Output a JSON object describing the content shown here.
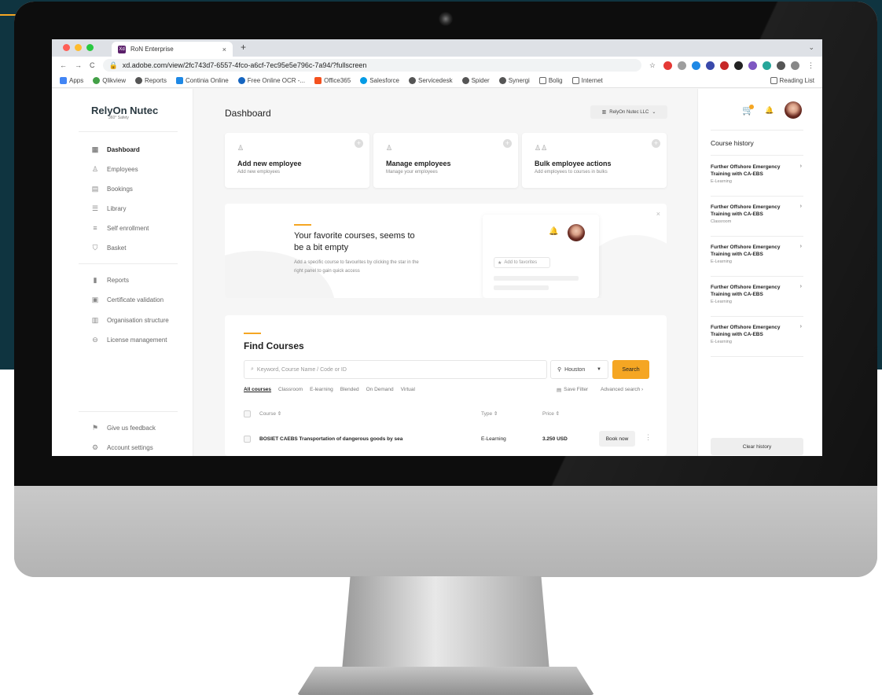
{
  "browser": {
    "tab_title": "RoN Enterprise",
    "tab_close": "×",
    "new_tab": "+",
    "tab_menu": "⌄",
    "url": "xd.adobe.com/view/2fc743d7-6557-4fco-a6cf-7ec95e5e796c-7a94/?fullscreen",
    "bookmarks": [
      "Apps",
      "Qlikview",
      "Reports",
      "Continia Online",
      "Free Online OCR -...",
      "Office365",
      "Salesforce",
      "Servicedesk",
      "Spider",
      "Synergi",
      "Bolig",
      "Internet"
    ],
    "reading_list": "Reading List"
  },
  "sidebar": {
    "logo": "RelyOn Nutec",
    "logo_sub": "360° Safety",
    "items": [
      "Dashboard",
      "Employees",
      "Bookings",
      "Library",
      "Self enrollment",
      "Basket"
    ],
    "items2": [
      "Reports",
      "Certificate validation",
      "Organisation structure",
      "License management"
    ],
    "bottom": [
      "Give us feedback",
      "Account settings"
    ]
  },
  "main": {
    "title": "Dashboard",
    "org_selector": "RelyOn Nutec LLC",
    "cards": [
      {
        "title": "Add new employee",
        "sub": "Add new employees"
      },
      {
        "title": "Manage employees",
        "sub": "Manage your employees"
      },
      {
        "title": "Bulk employee actions",
        "sub": "Add employees to courses in bulks"
      }
    ],
    "favorites": {
      "title": "Your favorite courses, seems to be a bit empty",
      "text": "Add a specific course to favourites by clicking the star in the right panel to gain quick access",
      "add_label": "Add to favorites"
    },
    "find": {
      "title": "Find Courses",
      "search_placeholder": "Keyword, Course Name / Code or ID",
      "location": "Houston",
      "search_button": "Search",
      "filters": [
        "All courses",
        "Classroom",
        "E-learning",
        "Blended",
        "On Demand",
        "Virtual"
      ],
      "save_filter": "Save Filter",
      "advanced": "Advanced search",
      "columns": [
        "Course",
        "Type",
        "Price"
      ],
      "rows": [
        {
          "course": "BOSIET CAEBS Transportation of dangerous goods by sea",
          "type": "E-Learning",
          "price": "3.250 USD",
          "action": "Book now"
        }
      ]
    }
  },
  "right": {
    "history_title": "Course history",
    "history": [
      {
        "name": "Further Offshore Emergency Training with CA-EBS",
        "type": "E-Learning"
      },
      {
        "name": "Further Offshore Emergency Training with CA-EBS",
        "type": "Classroom"
      },
      {
        "name": "Further Offshore Emergency Training with CA-EBS",
        "type": "E-Learning"
      },
      {
        "name": "Further Offshore Emergency Training with CA-EBS",
        "type": "E-Learning"
      },
      {
        "name": "Further Offshore Emergency Training with CA-EBS",
        "type": "E-Learning"
      }
    ],
    "clear_button": "Clear history"
  },
  "colors": {
    "accent": "#f5a623",
    "background_dark": "#0f3440"
  }
}
